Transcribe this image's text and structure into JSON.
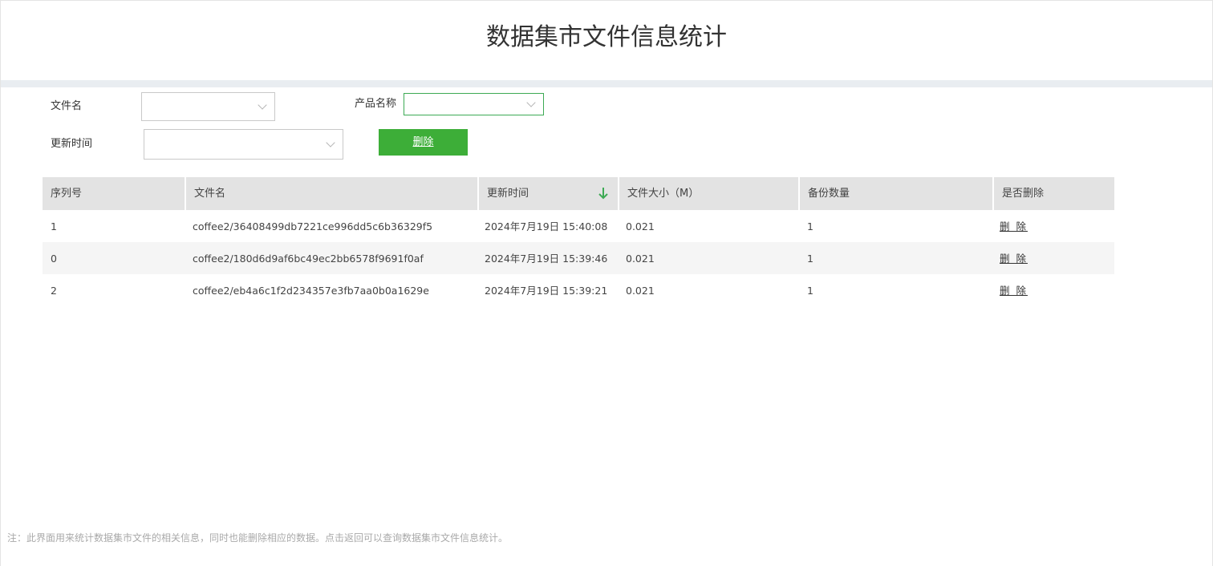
{
  "header": {
    "title": "数据集市文件信息统计"
  },
  "filters": {
    "file_name_label": "文件名",
    "product_name_label": "产品名称",
    "update_time_label": "更新时间",
    "delete_button_label": "删除"
  },
  "table": {
    "columns": [
      "序列号",
      "文件名",
      "更新时间",
      "文件大小（M）",
      "备份数量",
      "是否删除"
    ],
    "rows": [
      {
        "id": "1",
        "file": "coffee2/36408499db7221ce996dd5c6b36329f5",
        "time": "2024年7月19日 15:40:08",
        "size": "0.021",
        "backups": "1",
        "action": "删 除"
      },
      {
        "id": "0",
        "file": "coffee2/180d6d9af6bc49ec2bb6578f9691f0af",
        "time": "2024年7月19日 15:39:46",
        "size": "0.021",
        "backups": "1",
        "action": "删 除"
      },
      {
        "id": "2",
        "file": "coffee2/eb4a6c1f2d234357e3fb7aa0b0a1629e",
        "time": "2024年7月19日 15:39:21",
        "size": "0.021",
        "backups": "1",
        "action": "删 除"
      }
    ],
    "sort_icon": "arrow-down-icon",
    "sort_icon_color": "#3daa54"
  },
  "footer": {
    "note": "注：此界面用来统计数据集市文件的相关信息，同时也能删除相应的数据。点击返回可以查询数据集市文件信息统计。"
  },
  "colors": {
    "accent": "#3dae38",
    "header_band": "#e9edf1",
    "table_header": "#e3e3e3"
  }
}
